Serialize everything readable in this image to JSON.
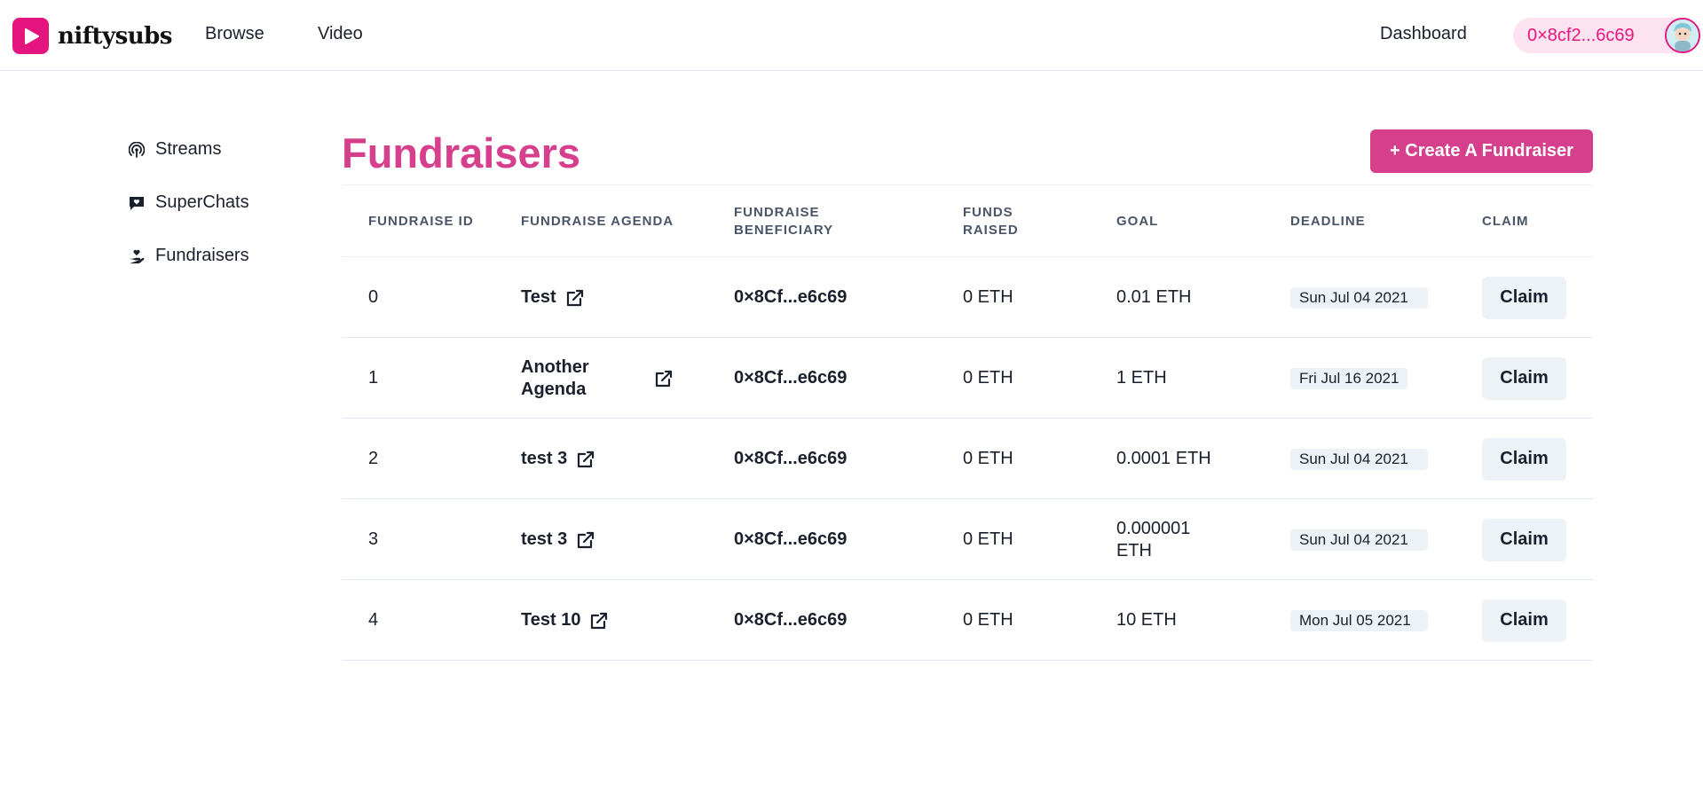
{
  "header": {
    "logo_text": "niftysubs",
    "nav": {
      "browse": "Browse",
      "video": "Video",
      "dashboard": "Dashboard"
    },
    "wallet_address": "0×8cf2...6c69"
  },
  "sidebar": {
    "items": [
      {
        "label": "Streams",
        "icon": "broadcast-icon"
      },
      {
        "label": "SuperChats",
        "icon": "chat-icon"
      },
      {
        "label": "Fundraisers",
        "icon": "hand-heart-icon"
      }
    ]
  },
  "main": {
    "title": "Fundraisers",
    "create_button": "+ Create A Fundraiser",
    "columns": {
      "id": "Fundraise ID",
      "agenda": "Fundraise Agenda",
      "beneficiary": "Fundraise Beneficiary",
      "funds": "Funds Raised",
      "goal": "Goal",
      "deadline": "Deadline",
      "claim": "Claim"
    },
    "rows": [
      {
        "id": "0",
        "agenda": "Test",
        "beneficiary": "0×8Cf...e6c69",
        "funds": "0 ETH",
        "goal": "0.01 ETH",
        "deadline": "Sun Jul 04 2021",
        "claim": "Claim"
      },
      {
        "id": "1",
        "agenda": "Another Agenda",
        "beneficiary": "0×8Cf...e6c69",
        "funds": "0 ETH",
        "goal": "1 ETH",
        "deadline": "Fri Jul 16 2021",
        "claim": "Claim"
      },
      {
        "id": "2",
        "agenda": "test 3",
        "beneficiary": "0×8Cf...e6c69",
        "funds": "0 ETH",
        "goal": "0.0001 ETH",
        "deadline": "Sun Jul 04 2021",
        "claim": "Claim"
      },
      {
        "id": "3",
        "agenda": "test 3",
        "beneficiary": "0×8Cf...e6c69",
        "funds": "0 ETH",
        "goal": "0.000001 ETH",
        "deadline": "Sun Jul 04 2021",
        "claim": "Claim"
      },
      {
        "id": "4",
        "agenda": "Test 10",
        "beneficiary": "0×8Cf...e6c69",
        "funds": "0 ETH",
        "goal": "10 ETH",
        "deadline": "Mon Jul 05 2021",
        "claim": "Claim"
      }
    ]
  },
  "colors": {
    "brand": "#e5157f",
    "accent": "#d63f8c",
    "wallet_bg": "#fde2ef",
    "badge_bg": "#edf2f7"
  }
}
